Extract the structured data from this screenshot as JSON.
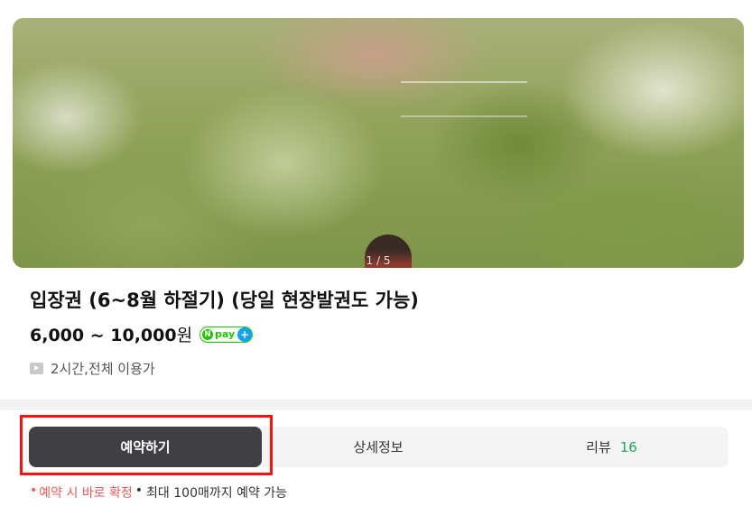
{
  "hero": {
    "image_alt": "",
    "counter": "1 / 5"
  },
  "product": {
    "title": "입장권 (6~8월 하절기) (당일 현장발권도 가능)",
    "price": "6,000 ~ 10,000",
    "price_unit": "원",
    "npay_label": "pay",
    "meta": "2시간,전체 이용가"
  },
  "tabs": [
    {
      "label": "예약하기",
      "active": true
    },
    {
      "label": "상세정보"
    },
    {
      "label": "리뷰",
      "count": "16"
    }
  ],
  "notice": {
    "highlight": "예약 시 바로 확정",
    "text": "최대 100매까지 예약 가능"
  },
  "colors": {
    "accent_red": "#ff1010",
    "review_count": "#1fa85a",
    "npay_green": "#1ec800"
  }
}
